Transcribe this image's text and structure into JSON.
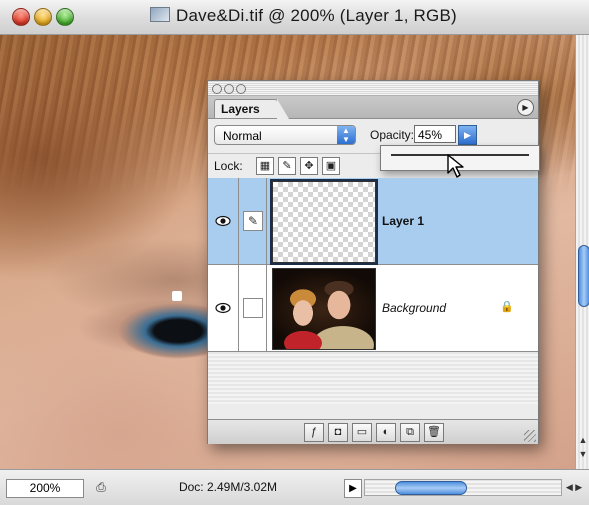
{
  "window": {
    "title": "Dave&Di.tif @ 200% (Layer 1, RGB)"
  },
  "statusbar": {
    "zoom": "200%",
    "doc_info": "Doc: 2.49M/3.02M"
  },
  "layers_palette": {
    "tab_label": "Layers",
    "blend_mode": "Normal",
    "opacity_label": "Opacity:",
    "opacity_value": "45%",
    "lock_label": "Lock:",
    "layers": [
      {
        "name": "Layer 1",
        "selected": true,
        "visible": true
      },
      {
        "name": "Background",
        "selected": false,
        "visible": true,
        "locked": true
      }
    ],
    "bottom_buttons": [
      "layer-style-icon",
      "layer-mask-icon",
      "new-set-icon",
      "adjustment-layer-icon",
      "new-layer-icon",
      "trash-icon"
    ]
  },
  "colors": {
    "selection_blue": "#a9cdef",
    "accent_blue": "#2d6fd0"
  }
}
